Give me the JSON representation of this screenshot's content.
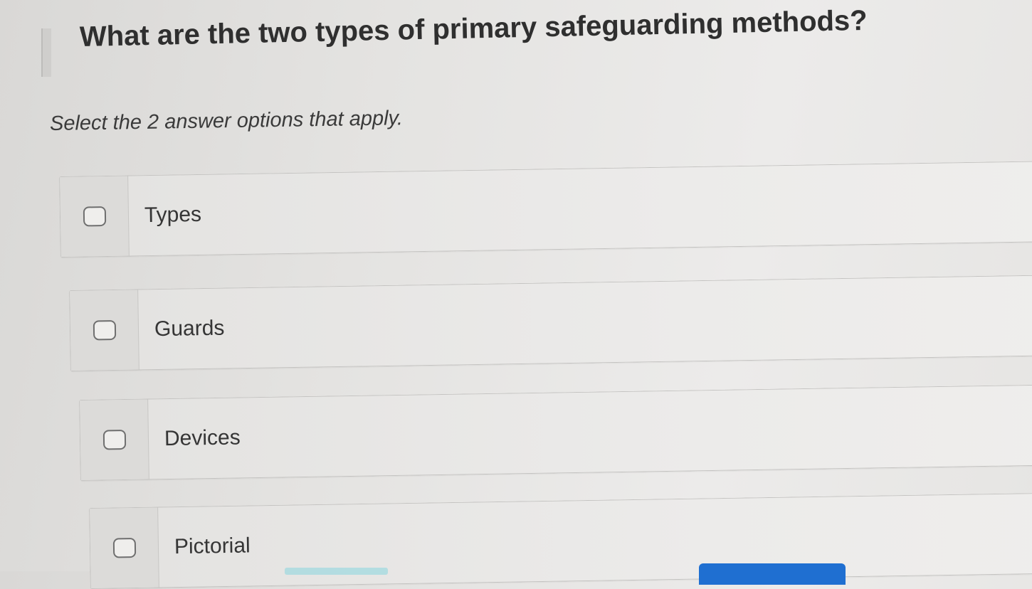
{
  "question": {
    "text": "What are the two types of primary safeguarding methods?",
    "instruction": "Select the 2 answer options that apply."
  },
  "options": [
    {
      "label": "Types",
      "checked": false
    },
    {
      "label": "Guards",
      "checked": false
    },
    {
      "label": "Devices",
      "checked": false
    },
    {
      "label": "Pictorial",
      "checked": false
    }
  ],
  "colors": {
    "accent": "#1f6fd1",
    "background": "#e8e7e5"
  }
}
